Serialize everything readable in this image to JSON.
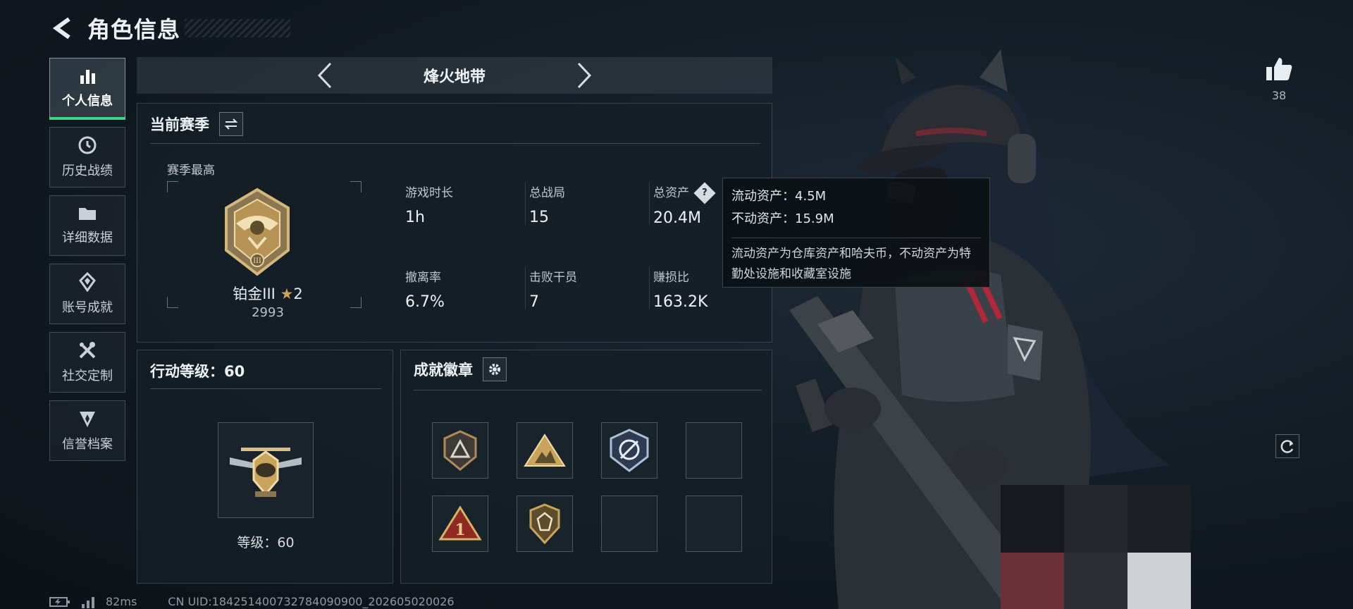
{
  "header": {
    "title": "角色信息"
  },
  "sidebar": {
    "items": [
      {
        "label": "个人信息",
        "icon": "bar-chart-icon",
        "active": true
      },
      {
        "label": "历史战绩",
        "icon": "history-clock-icon",
        "active": false
      },
      {
        "label": "详细数据",
        "icon": "folder-icon",
        "active": false
      },
      {
        "label": "账号成就",
        "icon": "achievement-icon",
        "active": false
      },
      {
        "label": "社交定制",
        "icon": "tools-icon",
        "active": false
      },
      {
        "label": "信誉档案",
        "icon": "shield-icon",
        "active": false
      }
    ]
  },
  "mode": {
    "title": "烽火地带"
  },
  "season": {
    "title": "当前赛季",
    "best_label": "赛季最高",
    "rank_name": "铂金III",
    "rank_stars": "2",
    "rank_score": "2993",
    "stats": [
      {
        "label": "游戏时长",
        "value": "1h"
      },
      {
        "label": "总战局",
        "value": "15"
      },
      {
        "label": "总资产",
        "value": "20.4M"
      },
      {
        "label": "撤离率",
        "value": "6.7%"
      },
      {
        "label": "击败干员",
        "value": "7"
      },
      {
        "label": "赚损比",
        "value": "163.2K"
      }
    ]
  },
  "tooltip": {
    "liquid": "流动资产：4.5M",
    "fixed": "不动资产：15.9M",
    "desc": "流动资产为仓库资产和哈夫币，不动资产为特勤处设施和收藏室设施"
  },
  "level": {
    "title": "行动等级：60",
    "text": "等级：60"
  },
  "achievements": {
    "title": "成就徽章",
    "badges": [
      "triangle-badge",
      "mountain-badge",
      "crest-badge",
      "empty",
      "number-one-badge",
      "skull-shield-badge",
      "empty",
      "empty"
    ]
  },
  "likes": {
    "count": "38"
  },
  "footer": {
    "ping": "82ms",
    "uid": "CN UID:184251400732784090900_202605020026"
  },
  "colors": {
    "accent": "#3ed38a",
    "gold": "#c9a45c"
  }
}
